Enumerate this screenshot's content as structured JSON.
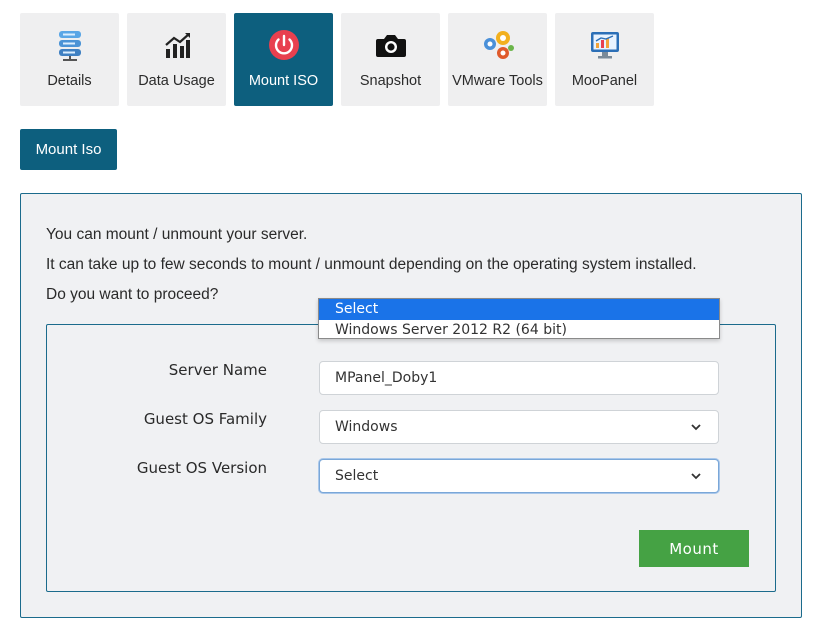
{
  "tabs": [
    {
      "label": "Details",
      "icon": "server-stack-icon"
    },
    {
      "label": "Data Usage",
      "icon": "bar-chart-icon"
    },
    {
      "label": "Mount ISO",
      "icon": "power-icon",
      "active": true
    },
    {
      "label": "Snapshot",
      "icon": "camera-icon"
    },
    {
      "label": "VMware Tools",
      "icon": "gears-icon"
    },
    {
      "label": "MooPanel",
      "icon": "monitor-chart-icon"
    }
  ],
  "action_button": "Mount Iso",
  "intro": {
    "line1": "You can mount / unmount your server.",
    "line2": "It can take up to few seconds to mount / unmount depending on the operating system installed.",
    "line3": "Do you want to proceed?"
  },
  "form": {
    "server_name_label": "Server Name",
    "server_name_value": "MPanel_Doby1",
    "os_family_label": "Guest OS Family",
    "os_family_value": "Windows",
    "os_version_label": "Guest OS Version",
    "os_version_value": "Select",
    "os_version_options": [
      "Select",
      "Windows Server 2012 R2 (64 bit)"
    ],
    "submit_label": "Mount"
  },
  "colors": {
    "primary": "#0d5f7e",
    "success": "#45a244",
    "selected_option": "#1a73e8",
    "power_icon": "#e8404f"
  }
}
